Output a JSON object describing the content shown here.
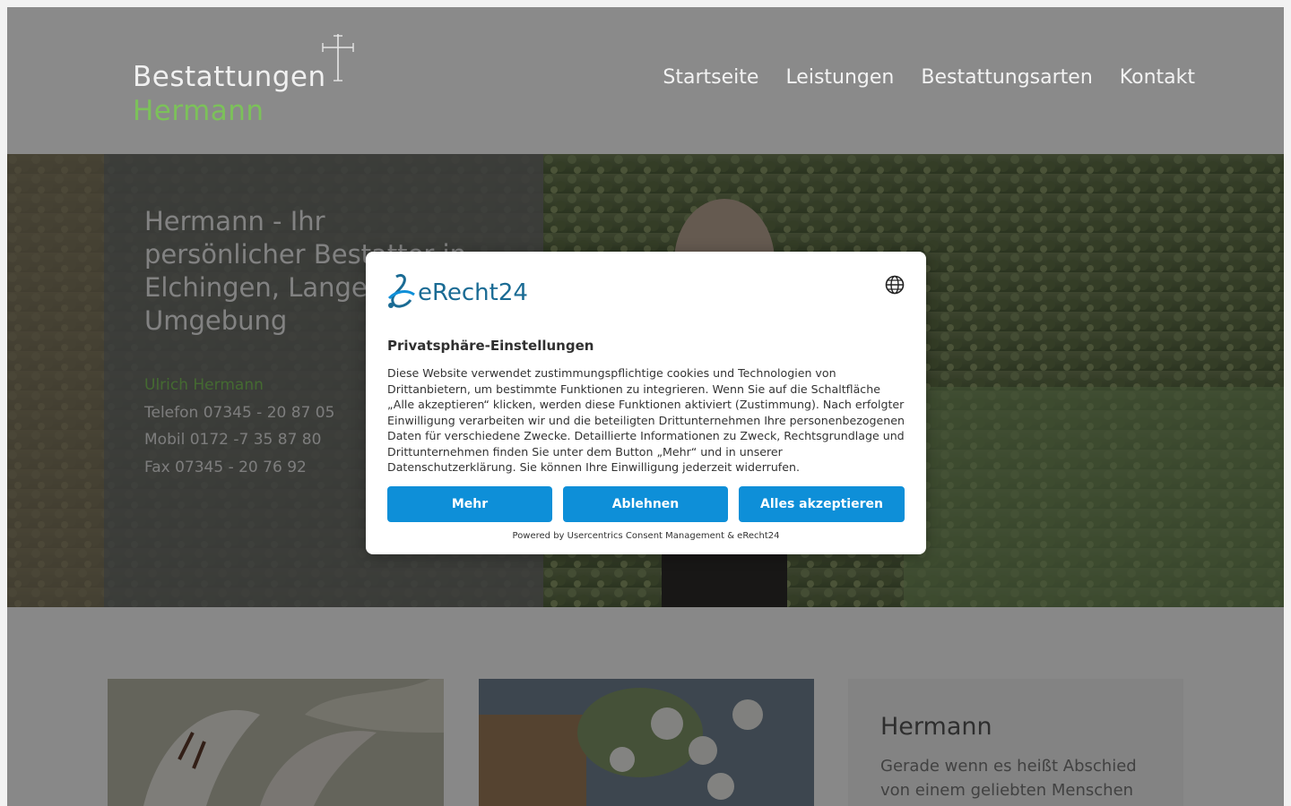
{
  "logo": {
    "line1": "Bestattungen",
    "line2": "Hermann"
  },
  "nav": [
    "Startseite",
    "Leistungen",
    "Bestattungsarten",
    "Kontakt"
  ],
  "hero": {
    "title": "Hermann - Ihr persönlicher Bestatter in Elchingen, Langenau und Umgebung",
    "contact_name": "Ulrich Hermann",
    "phone": "Telefon 07345 - 20 87 05",
    "mobile": "Mobil 0172 -7 35 87 80",
    "fax": "Fax 07345 - 20 76 92"
  },
  "content": {
    "card_title": "Hermann",
    "card_body": "Gerade wenn es heißt Abschied von einem geliebten Menschen"
  },
  "consent": {
    "brand": "eRecht24",
    "title": "Privatsphäre-Einstellungen",
    "body": "Diese Website verwendet zustimmungspflichtige cookies und Technologien von Drittanbietern, um bestimmte Funktionen zu integrieren. Wenn Sie auf die Schaltfläche „Alle akzeptieren“ klicken, werden diese Funktionen aktiviert (Zustimmung). Nach erfolgter Einwilligung verarbeiten wir und die beteiligten Drittunternehmen Ihre personenbezogenen Daten für verschiedene Zwecke. Detaillierte Informationen zu Zweck, Rechtsgrundlage und Drittunternehmen finden Sie unter dem Button „Mehr“ und in unserer Datenschutzerklärung. Sie können Ihre Einwilligung jederzeit widerrufen.",
    "btn_more": "Mehr",
    "btn_decline": "Ablehnen",
    "btn_accept": "Alles akzeptieren",
    "powered": "Powered by Usercentrics Consent Management & eRecht24"
  },
  "colors": {
    "accent_green": "#7cc15a",
    "button_blue": "#0e8fd8",
    "brand_blue": "#1a6b94"
  }
}
